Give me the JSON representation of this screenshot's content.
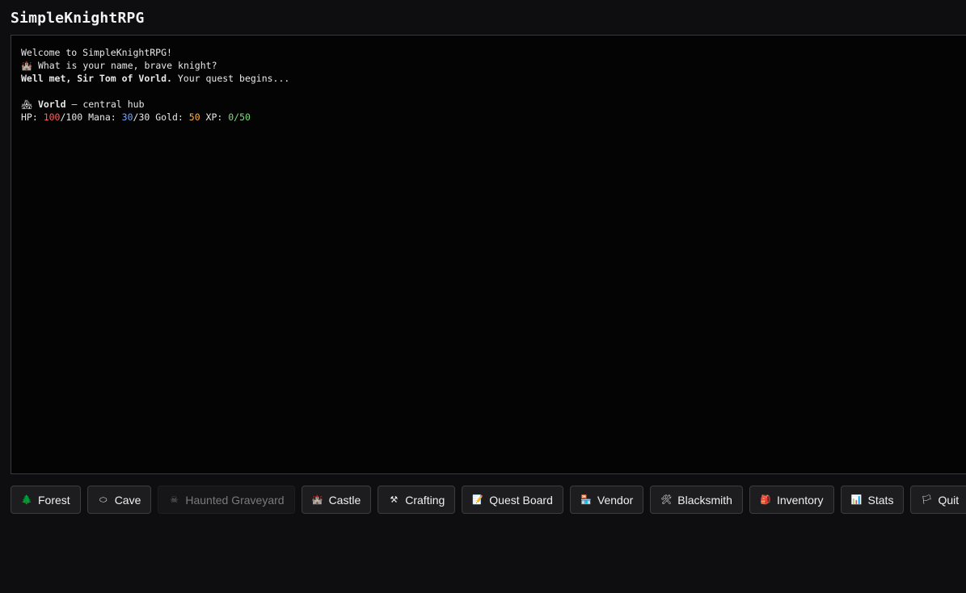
{
  "app": {
    "title": "SimpleKnightRPG"
  },
  "log": {
    "welcome": "Welcome to SimpleKnightRPG!",
    "name_prompt_icon": "castle-icon",
    "name_prompt_glyph": "🏰",
    "name_prompt": "What is your name, brave knight?",
    "greeting_bold": "Well met, Sir Tom of Vorld.",
    "greeting_rest": " Your quest begins...",
    "location_icon": "hub-house-icon",
    "location_glyph": "🏘",
    "location_name": "Vorld",
    "location_desc": " — central hub"
  },
  "stats": {
    "hp_label": "HP: ",
    "hp_current": "100",
    "hp_max": "/100",
    "mana_label": " Mana: ",
    "mana_current": "30",
    "mana_max": "/30",
    "gold_label": " Gold: ",
    "gold": "50",
    "xp_label": " XP: ",
    "xp": "0/50"
  },
  "colors": {
    "hp": "#ff5f5f",
    "mana": "#6fa8ff",
    "gold": "#ffb347",
    "xp": "#7ddc7d",
    "terminal_bg": "#040404",
    "page_bg": "#0e0e10"
  },
  "actions": [
    {
      "label": "Forest",
      "icon": "tree-icon",
      "glyph": "🌲",
      "enabled": true
    },
    {
      "label": "Cave",
      "icon": "cave-icon",
      "glyph": "⬭",
      "enabled": true
    },
    {
      "label": "Haunted Graveyard",
      "icon": "skull-icon",
      "glyph": "☠",
      "enabled": false
    },
    {
      "label": "Castle",
      "icon": "castle-icon",
      "glyph": "🏰",
      "enabled": true
    },
    {
      "label": "Crafting",
      "icon": "hammer-pick-icon",
      "glyph": "⚒",
      "enabled": true
    },
    {
      "label": "Quest Board",
      "icon": "memo-icon",
      "glyph": "📝",
      "enabled": true
    },
    {
      "label": "Vendor",
      "icon": "shop-icon",
      "glyph": "🏪",
      "enabled": true
    },
    {
      "label": "Blacksmith",
      "icon": "tools-icon",
      "glyph": "🛠",
      "enabled": true
    },
    {
      "label": "Inventory",
      "icon": "backpack-icon",
      "glyph": "🎒",
      "enabled": true
    },
    {
      "label": "Stats",
      "icon": "bar-chart-icon",
      "glyph": "📊",
      "enabled": true
    },
    {
      "label": "Quit",
      "icon": "flag-icon",
      "glyph": "🏳",
      "enabled": true
    }
  ]
}
